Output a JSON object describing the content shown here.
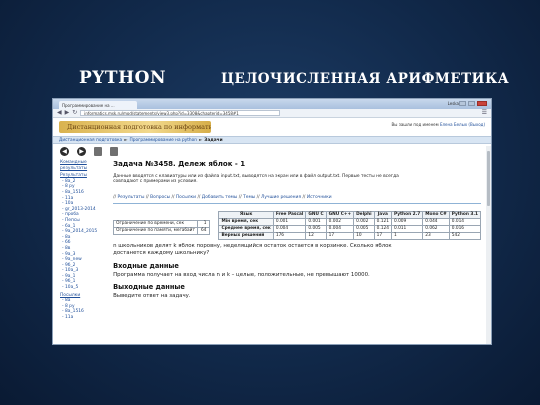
{
  "slide": {
    "title_left": "PYTHON",
    "title_right": "ЦЕЛОЧИСЛЕННАЯ АРИФМЕТИКА"
  },
  "browser": {
    "tab_label": "Программирование на ...",
    "user_label": "Leska",
    "url": "informatics.msk.ru/mod/statements/view3.php?id=3308&chapterid=3458#1"
  },
  "site": {
    "logo_text": "Дистанционная подготовка по информатике",
    "user_line_prefix": "Вы зашли под именем",
    "user_name": "Елена Белых (Выход)"
  },
  "breadcrumb": [
    "Дистанционная подготовка",
    "Программирование на python",
    "Задачи"
  ],
  "toolbar_icons": [
    "prev-icon",
    "next-icon",
    "print-icon",
    "document-icon"
  ],
  "sidebar": {
    "sections": [
      {
        "head": "Командные результаты",
        "items": []
      },
      {
        "head": "Результаты",
        "items": [
          "- 8а_2",
          "- 8 ру",
          "- 8а_1516",
          "- 11а",
          "- 10а",
          "- gr_2013-2014",
          "- проба",
          "- Пепсы",
          "- 6а_1",
          "- 9а_2014_2015",
          "- 8а",
          "- 6б",
          "- 8в",
          "- 9а_3",
          "- 9а_new",
          "- 9б_2",
          "- 10а_3",
          "- 9а_1",
          "- 9б_1",
          "- 10а_5"
        ]
      },
      {
        "head": "Посылки",
        "items": [
          "- 8а",
          "- 8 ру",
          "- 8а_1516",
          "- 11а"
        ]
      }
    ]
  },
  "problem": {
    "title": "Задача №3458. Дележ яблок - 1",
    "desc": "Данные вводятся с клавиатуры или из файла input.txt, выводятся на экран или в файл output.txt. Первые тесты не всегда совпадают с примерами из условия.",
    "links": [
      "Результаты",
      "Вопросы",
      "Посылки",
      "Добавить темы",
      "Темы",
      "Лучшие решения",
      "Источники"
    ],
    "limits": [
      {
        "label": "Ограничение по времени, сек",
        "value": "1"
      },
      {
        "label": "Ограничение по памяти, мегабайт",
        "value": "64"
      }
    ],
    "lang_table": {
      "headers": [
        "Язык",
        "Free Pascal",
        "GNU C",
        "GNU C++",
        "Delphi",
        "Java",
        "Python 2.7",
        "Mono C#",
        "Python 3.1"
      ],
      "rows": [
        [
          "Мін время, сек",
          "0.001",
          "0.001",
          "0.002",
          "0.002",
          "0.121",
          "0.009",
          "0.044",
          "0.014"
        ],
        [
          "Среднее время, сек",
          "0.004",
          "0.005",
          "0.004",
          "0.005",
          "0.124",
          "0.011",
          "0.062",
          "0.016"
        ],
        [
          "Верных решений",
          "176",
          "12",
          "17",
          "10",
          "17",
          "1",
          "23",
          "542"
        ]
      ]
    },
    "statement": "n школьников делят k яблок поровну, неделящийся остаток остается в корзинке. Сколько яблок достанется каждому школьнику?",
    "input_head": "Входные данные",
    "input_text": "Программа получает на вход числа n и k – целые, положительные, не превышают 10000.",
    "output_head": "Выходные данные",
    "output_text": "Выведите ответ на задачу."
  }
}
